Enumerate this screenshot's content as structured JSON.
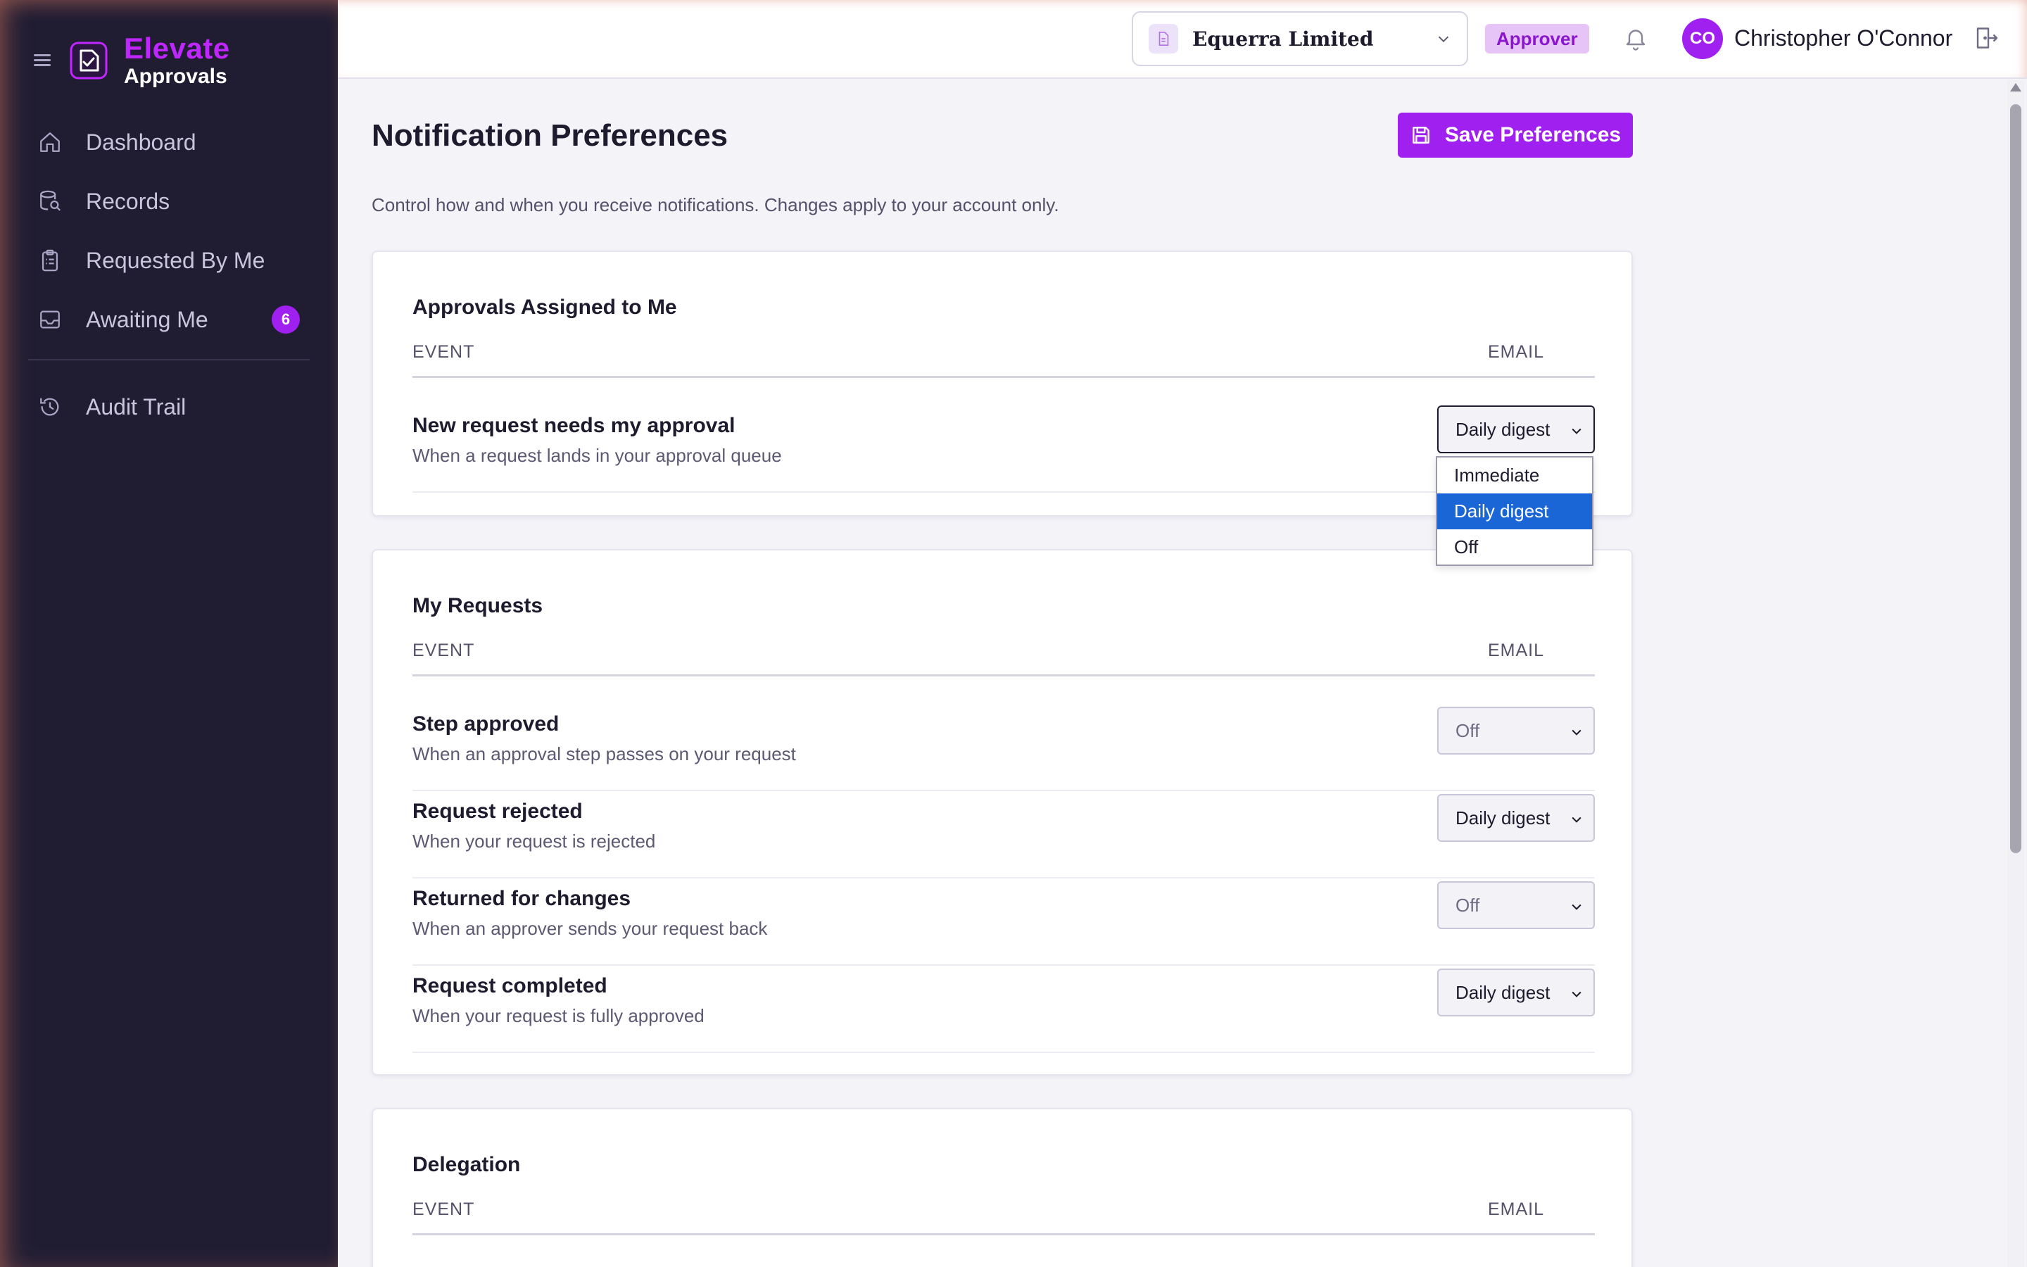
{
  "brand": {
    "title": "Elevate",
    "subtitle": "Approvals"
  },
  "sidebar": {
    "items": [
      {
        "label": "Dashboard",
        "icon": "home-icon"
      },
      {
        "label": "Records",
        "icon": "database-search-icon"
      },
      {
        "label": "Requested By Me",
        "icon": "clipboard-list-icon"
      },
      {
        "label": "Awaiting Me",
        "icon": "inbox-icon",
        "badge": "6"
      },
      {
        "label": "Audit Trail",
        "icon": "history-icon"
      }
    ]
  },
  "topbar": {
    "org_name": "Equerra Limited",
    "role": "Approver",
    "user_initials": "CO",
    "user_name": "Christopher O'Connor"
  },
  "page": {
    "title": "Notification Preferences",
    "save_label": "Save Preferences",
    "description": "Control how and when you receive notifications. Changes apply to your account only."
  },
  "columns": {
    "event": "EVENT",
    "email": "EMAIL"
  },
  "sections": [
    {
      "title": "Approvals Assigned to Me",
      "rows": [
        {
          "title": "New request needs my approval",
          "desc": "When a request lands in your approval queue",
          "value": "Daily digest"
        }
      ]
    },
    {
      "title": "My Requests",
      "rows": [
        {
          "title": "Step approved",
          "desc": "When an approval step passes on your request",
          "value": "Off"
        },
        {
          "title": "Request rejected",
          "desc": "When your request is rejected",
          "value": "Daily digest"
        },
        {
          "title": "Returned for changes",
          "desc": "When an approver sends your request back",
          "value": "Off"
        },
        {
          "title": "Request completed",
          "desc": "When your request is fully approved",
          "value": "Daily digest"
        }
      ]
    },
    {
      "title": "Delegation",
      "rows": []
    }
  ],
  "dropdown": {
    "options": [
      "Immediate",
      "Daily digest",
      "Off"
    ],
    "selected": "Daily digest"
  },
  "colors": {
    "accent": "#a020f0",
    "sidebar": "#201d33",
    "selection": "#1a66d6"
  }
}
